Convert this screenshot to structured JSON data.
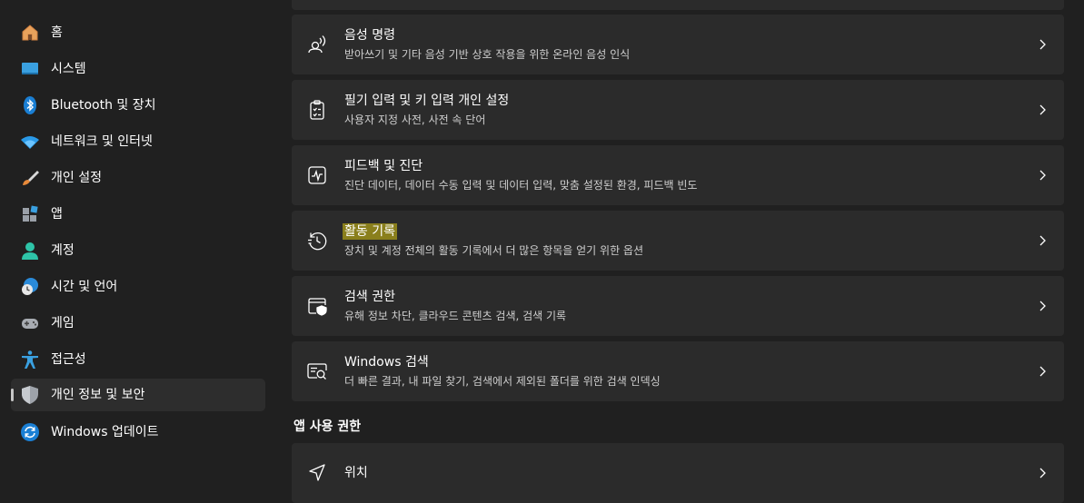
{
  "sidebar": {
    "items": [
      {
        "label": "홈",
        "icon": "home-icon"
      },
      {
        "label": "시스템",
        "icon": "display-icon"
      },
      {
        "label": "Bluetooth 및 장치",
        "icon": "bluetooth-icon"
      },
      {
        "label": "네트워크 및 인터넷",
        "icon": "wifi-icon"
      },
      {
        "label": "개인 설정",
        "icon": "paintbrush-icon"
      },
      {
        "label": "앱",
        "icon": "apps-icon"
      },
      {
        "label": "계정",
        "icon": "person-icon"
      },
      {
        "label": "시간 및 언어",
        "icon": "globe-clock-icon"
      },
      {
        "label": "게임",
        "icon": "gamepad-icon"
      },
      {
        "label": "접근성",
        "icon": "accessibility-icon"
      },
      {
        "label": "개인 정보 및 보안",
        "icon": "shield-icon",
        "selected": true
      },
      {
        "label": "Windows 업데이트",
        "icon": "update-icon"
      }
    ]
  },
  "main": {
    "cards": [
      {
        "title": "음성 명령",
        "desc": "받아쓰기 및 기타 음성 기반 상호 작용을 위한 온라인 음성 인식",
        "icon": "speech-icon"
      },
      {
        "title": "필기 입력 및 키 입력 개인 설정",
        "desc": "사용자 지정 사전, 사전 속 단어",
        "icon": "clipboard-checklist-icon"
      },
      {
        "title": "피드백 및 진단",
        "desc": "진단 데이터, 데이터 수동 입력 및 데이터 입력, 맞춤 설정된 환경, 피드백 빈도",
        "icon": "diagnostics-icon"
      },
      {
        "title": "활동 기록",
        "desc": "장치 및 계정 전체의 활동 기록에서 더 많은 항목을 얻기 위한 옵션",
        "icon": "history-icon",
        "highlight": true
      },
      {
        "title": "검색 권한",
        "desc": "유해 정보 차단, 클라우드 콘텐츠 검색, 검색 기록",
        "icon": "search-permissions-icon"
      },
      {
        "title": "Windows 검색",
        "desc": "더 빠른 결과, 내 파일 찾기, 검색에서 제외된 폴더를 위한 검색 인덱싱",
        "icon": "windows-search-icon"
      }
    ],
    "section_heading": "앱 사용 권한",
    "location_card": {
      "title": "위치",
      "icon": "location-icon"
    }
  },
  "colors": {
    "background": "#202020",
    "card": "#2b2b2b",
    "selected_nav": "#2d2d2d",
    "highlight": "#8a7f1c",
    "accent_blue": "#0078d4"
  }
}
